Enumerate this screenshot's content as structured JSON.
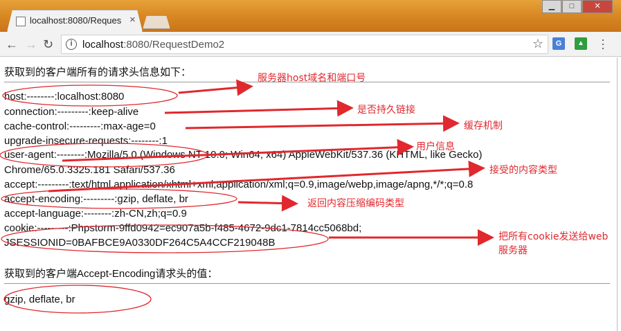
{
  "browser": {
    "tab_title": "localhost:8080/Reques",
    "tab_close": "×",
    "url_host": "localhost",
    "url_rest": ":8080/RequestDemo2",
    "info_glyph": "i",
    "ext1_label": "G",
    "ext2_label": "▲",
    "icons": [
      "back-icon",
      "forward-icon",
      "reload-icon",
      "info-icon",
      "star-icon",
      "menu-icon"
    ]
  },
  "page": {
    "heading1": "获取到的客户端所有的请求头信息如下：",
    "headers": [
      "host:--------:localhost:8080",
      "connection:---------:keep-alive",
      "cache-control:---------:max-age=0",
      "upgrade-insecure-requests:--------:1",
      "user-agent:--------:Mozilla/5.0 (Windows NT 10.0; Win64; x64) AppleWebKit/537.36 (KHTML, like Gecko)",
      "Chrome/65.0.3325.181 Safari/537.36",
      "accept:---------:text/html,application/xhtml+xml,application/xml;q=0.9,image/webp,image/apng,*/*;q=0.8",
      "accept-encoding:---------:gzip, deflate, br",
      "accept-language:--------:zh-CN,zh;q=0.9",
      "cookie:---------:Phpstorm-9ffd0942=ec907a5b-f485-4672-9dc1-7814cc5068bd;",
      "JSESSIONID=0BAFBCE9A0330DF264C5A4CCF219048B"
    ],
    "heading2": "获取到的客户端Accept-Encoding请求头的值：",
    "value": "gzip, deflate, br"
  },
  "annotations": {
    "host": "服务器host域名和端口号",
    "connection": "是否持久链接",
    "cache": "缓存机制",
    "user_agent": "用户信息",
    "accept": "接受的内容类型",
    "encoding": "返回内容压缩编码类型",
    "cookie_line1": "把所有cookie发送给web",
    "cookie_line2": "服务器"
  },
  "colors": {
    "annotation_red": "#e0282e",
    "titlebar_orange": "#d98a24"
  }
}
